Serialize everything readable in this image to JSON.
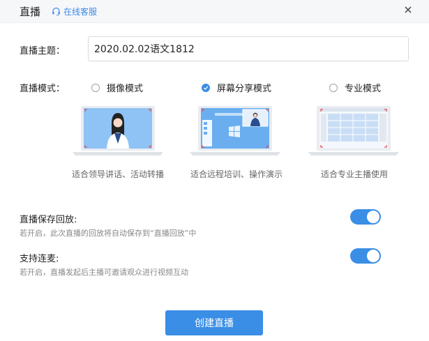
{
  "header": {
    "title": "直播",
    "customer_service": "在线客服",
    "close_icon": "close-icon"
  },
  "topic": {
    "label": "直播主题：",
    "value": "2020.02.02语文1812"
  },
  "mode": {
    "label": "直播模式：",
    "options": [
      {
        "label": "摄像模式",
        "checked": false,
        "caption": "适合领导讲话、活动转播"
      },
      {
        "label": "屏幕分享模式",
        "checked": true,
        "caption": "适合远程培训、操作演示"
      },
      {
        "label": "专业模式",
        "checked": false,
        "caption": "适合专业主播使用"
      }
    ]
  },
  "options": {
    "save_replay": {
      "title": "直播保存回放:",
      "desc": "若开启，此次直播的回放将自动保存到“直播回放”中",
      "enabled": true
    },
    "co_host": {
      "title": "支持连麦:",
      "desc": "若开启，直播发起后主播可邀请观众进行视频互动",
      "enabled": true
    }
  },
  "create_button": "创建直播",
  "colors": {
    "accent": "#3a8ee6",
    "link": "#3d8be6"
  }
}
